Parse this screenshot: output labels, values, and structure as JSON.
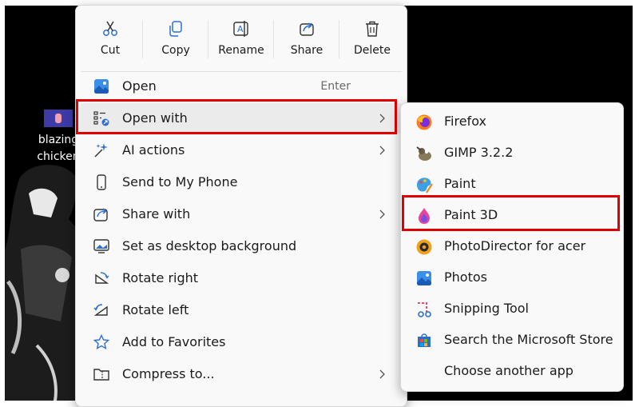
{
  "desktop": {
    "icon_label_line1": "blazing",
    "icon_label_line2": "chicken"
  },
  "quick_actions": [
    {
      "label": "Cut",
      "icon": "scissors-icon"
    },
    {
      "label": "Copy",
      "icon": "copy-icon"
    },
    {
      "label": "Rename",
      "icon": "rename-icon"
    },
    {
      "label": "Share",
      "icon": "share-icon"
    },
    {
      "label": "Delete",
      "icon": "trash-icon"
    }
  ],
  "menu": [
    {
      "label": "Open",
      "icon": "image-icon",
      "shortcut": "Enter"
    },
    {
      "label": "Open with",
      "icon": "open-with-icon",
      "submenu": true,
      "highlighted": true
    },
    {
      "label": "AI actions",
      "icon": "sparkle-icon",
      "submenu": true
    },
    {
      "label": "Send to My Phone",
      "icon": "phone-icon"
    },
    {
      "label": "Share with",
      "icon": "share-with-icon",
      "submenu": true
    },
    {
      "label": "Set as desktop background",
      "icon": "desktop-background-icon"
    },
    {
      "label": "Rotate right",
      "icon": "rotate-right-icon"
    },
    {
      "label": "Rotate left",
      "icon": "rotate-left-icon"
    },
    {
      "label": "Add to Favorites",
      "icon": "star-icon"
    },
    {
      "label": "Compress to...",
      "icon": "zip-folder-icon",
      "submenu": true
    }
  ],
  "open_with": [
    {
      "label": "Firefox",
      "icon": "firefox-icon"
    },
    {
      "label": "GIMP 3.2.2",
      "icon": "gimp-icon"
    },
    {
      "label": "Paint",
      "icon": "paint-icon"
    },
    {
      "label": "Paint 3D",
      "icon": "paint-3d-icon",
      "highlighted": true
    },
    {
      "label": "PhotoDirector for acer",
      "icon": "photodirector-icon"
    },
    {
      "label": "Photos",
      "icon": "photos-icon"
    },
    {
      "label": "Snipping Tool",
      "icon": "snipping-tool-icon"
    },
    {
      "label": "Search the Microsoft Store",
      "icon": "microsoft-store-icon"
    },
    {
      "label": "Choose another app",
      "icon": ""
    }
  ],
  "colors": {
    "highlight_box": "#e00000",
    "menu_bg": "#f9f9f9",
    "accent_blue": "#2b6fd6"
  }
}
